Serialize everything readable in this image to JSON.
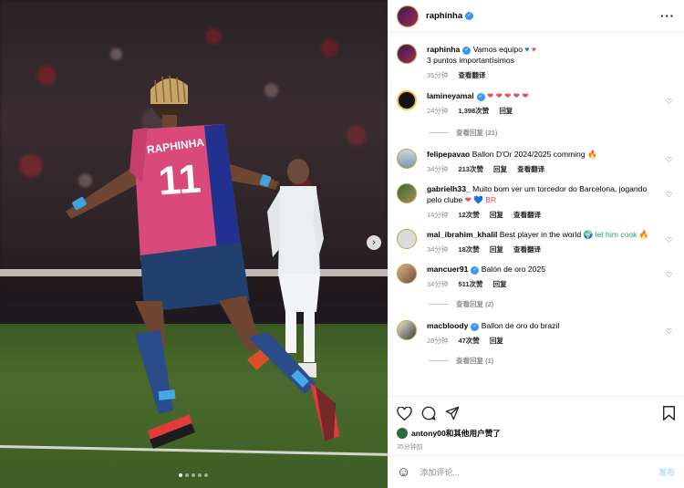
{
  "post": {
    "username": "raphinha",
    "slide_count": 5,
    "active_slide": 1
  },
  "caption": {
    "username": "raphinha",
    "text_line1": "Vamos equipo",
    "text_line2": "3 puntos importantísimos",
    "time": "35分钟",
    "translate": "查看翻译"
  },
  "comments": [
    {
      "username": "lamineyamal",
      "verified": true,
      "text": "",
      "emoji": "❤ ❤ ❤ ❤ ❤",
      "time": "24分钟",
      "likes": "1,398次赞",
      "reply": "回复",
      "translate": "",
      "replies_label": "查看回复 (21)"
    },
    {
      "username": "felipepavao",
      "verified": false,
      "text": "Ballon D'Or 2024/2025 comming",
      "emoji": "🔥",
      "time": "34分钟",
      "likes": "213次赞",
      "reply": "回复",
      "translate": "查看翻译",
      "replies_label": ""
    },
    {
      "username": "gabrielh33_",
      "verified": false,
      "text": "Muito bom ver um torcedor do Barcelona, jogando pelo clube",
      "emoji": "❤ 💙 BR",
      "time": "14分钟",
      "likes": "12次赞",
      "reply": "回复",
      "translate": "查看翻译",
      "replies_label": ""
    },
    {
      "username": "mal_ibrahim_khalil",
      "verified": false,
      "text": "Best player in the world",
      "emoji": "🌍 let him cook 🔥",
      "time": "34分钟",
      "likes": "18次赞",
      "reply": "回复",
      "translate": "查看翻译",
      "replies_label": ""
    },
    {
      "username": "mancuer91",
      "verified": true,
      "text": "Balón de oro 2025",
      "emoji": "",
      "time": "34分钟",
      "likes": "511次赞",
      "reply": "回复",
      "translate": "",
      "replies_label": "查看回复 (2)"
    },
    {
      "username": "macbloody",
      "verified": true,
      "text": "Ballon de oro do brazil",
      "emoji": "",
      "time": "28分钟",
      "likes": "47次赞",
      "reply": "回复",
      "translate": "",
      "replies_label": "查看回复 (1)"
    }
  ],
  "likes_row": {
    "user": "antony00",
    "suffix": "和其他用户赞了",
    "time": "35分钟前"
  },
  "composer": {
    "placeholder": "添加评论...",
    "post_label": "发布"
  },
  "colors": {
    "verified": "#3897f0",
    "accent_link": "#b3dbff",
    "muted": "#8e8e8e",
    "jersey_pink": "#d94a7a",
    "jersey_blue": "#22318f"
  }
}
